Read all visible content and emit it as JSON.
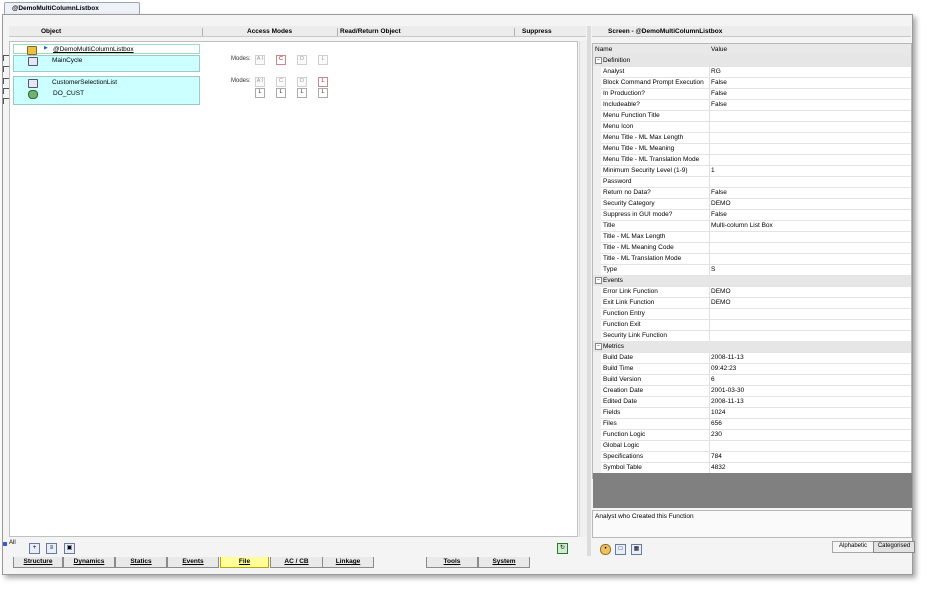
{
  "document_tab": "@DemoMultiColumnListbox",
  "columns": {
    "object": "Object",
    "access_modes": "Access Modes",
    "read_return": "Read/Return Object",
    "suppress": "Suppress"
  },
  "tree": {
    "root_label": "@DemoMultiColumnListbox",
    "main_cycle_label": "MainCycle",
    "customer_list_label": "CustomerSelectionList",
    "do_cust_label": "DO_CUST",
    "modes_label": "Modes:",
    "main_cycle_modes": [
      "A I",
      "C",
      "D",
      "L"
    ],
    "customer_modes": [
      "A I",
      "C",
      "D",
      "L"
    ],
    "do_cust_modes": [
      "L",
      "L",
      "L",
      "L"
    ]
  },
  "left_toolbar": {
    "all_label": "All"
  },
  "properties": {
    "screen_title": "Screen - @DemoMultiColumnListbox",
    "name_header": "Name",
    "value_header": "Value",
    "rows": [
      {
        "cat": true,
        "key": "Definition"
      },
      {
        "key": "Analyst",
        "val": "RG"
      },
      {
        "key": "Block Command Prompt Execution",
        "val": "False"
      },
      {
        "key": "In Production?",
        "val": "False"
      },
      {
        "key": "Includeable?",
        "val": "False"
      },
      {
        "key": "Menu Function Title",
        "val": ""
      },
      {
        "key": "Menu Icon",
        "val": ""
      },
      {
        "key": "Menu Title - ML Max Length",
        "val": ""
      },
      {
        "key": "Menu Title - ML Meaning",
        "val": ""
      },
      {
        "key": "Menu Title - ML Translation Mode",
        "val": ""
      },
      {
        "key": "Minimum Security Level (1-9)",
        "val": "1"
      },
      {
        "key": "Password",
        "val": ""
      },
      {
        "key": "Return no Data?",
        "val": "False"
      },
      {
        "key": "Security Category",
        "val": "DEMO"
      },
      {
        "key": "Suppress in GUI mode?",
        "val": "False"
      },
      {
        "key": "Title",
        "val": "Multi-column List Box"
      },
      {
        "key": "Title - ML Max Length",
        "val": ""
      },
      {
        "key": "Title - ML Meaning Code",
        "val": ""
      },
      {
        "key": "Title - ML Translation Mode",
        "val": ""
      },
      {
        "key": "Type",
        "val": "S"
      },
      {
        "cat": true,
        "key": "Events"
      },
      {
        "key": "Error Link Function",
        "val": "DEMO"
      },
      {
        "key": "Exit Link Function",
        "val": "DEMO"
      },
      {
        "key": "Function Entry",
        "val": ""
      },
      {
        "key": "Function Exit",
        "val": ""
      },
      {
        "key": "Security Link Function",
        "val": ""
      },
      {
        "cat": true,
        "key": "Metrics"
      },
      {
        "key": "Build Date",
        "val": "2008-11-13"
      },
      {
        "key": "Build Time",
        "val": "09:42:23"
      },
      {
        "key": "Build Version",
        "val": "6"
      },
      {
        "key": "Creation Date",
        "val": "2001-03-30"
      },
      {
        "key": "Edited Date",
        "val": "2008-11-13"
      },
      {
        "key": "Fields",
        "val": "1024"
      },
      {
        "key": "Files",
        "val": "656"
      },
      {
        "key": "Function Logic",
        "val": "230"
      },
      {
        "key": "Global Logic",
        "val": ""
      },
      {
        "key": "Specifications",
        "val": "784"
      },
      {
        "key": "Symbol Table",
        "val": "4832"
      }
    ],
    "description": "Analyst who Created this Function",
    "alphabetic_label": "Alphabetic",
    "categorised_label": "Categorised"
  },
  "bottom_tabs": [
    "Structure",
    "Dynamics",
    "Statics",
    "Events",
    "File",
    "AC / CB",
    "Linkage",
    "Tools",
    "System"
  ],
  "active_tab": "File"
}
